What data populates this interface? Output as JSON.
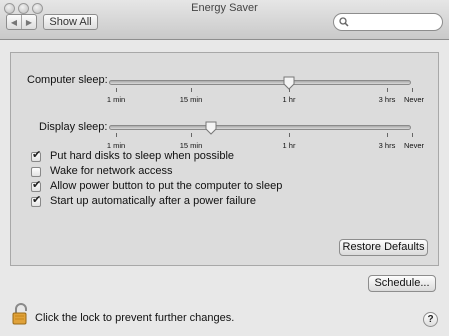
{
  "window": {
    "title": "Energy Saver"
  },
  "toolbar": {
    "back_icon": "back-arrow-icon",
    "forward_icon": "forward-arrow-icon",
    "back_glyph": "◀",
    "forward_glyph": "▶",
    "show_all_label": "Show All",
    "search_placeholder": "",
    "search_value": ""
  },
  "sleep": {
    "computer_label": "Computer sleep:",
    "display_label": "Display sleep:",
    "tick_labels": [
      "1 min",
      "15 min",
      "1 hr",
      "3 hrs",
      "Never"
    ],
    "computer_value": "1 hr",
    "display_value": "15 min"
  },
  "options": [
    {
      "label": "Put hard disks to sleep when possible",
      "checked": true
    },
    {
      "label": "Wake for network access",
      "checked": false
    },
    {
      "label": "Allow power button to put the computer to sleep",
      "checked": true
    },
    {
      "label": "Start up automatically after a power failure",
      "checked": true
    }
  ],
  "checkmark": "✔",
  "buttons": {
    "restore_defaults": "Restore Defaults",
    "schedule": "Schedule..."
  },
  "footer": {
    "lock_text": "Click the lock to prevent further changes.",
    "help_label": "?"
  }
}
